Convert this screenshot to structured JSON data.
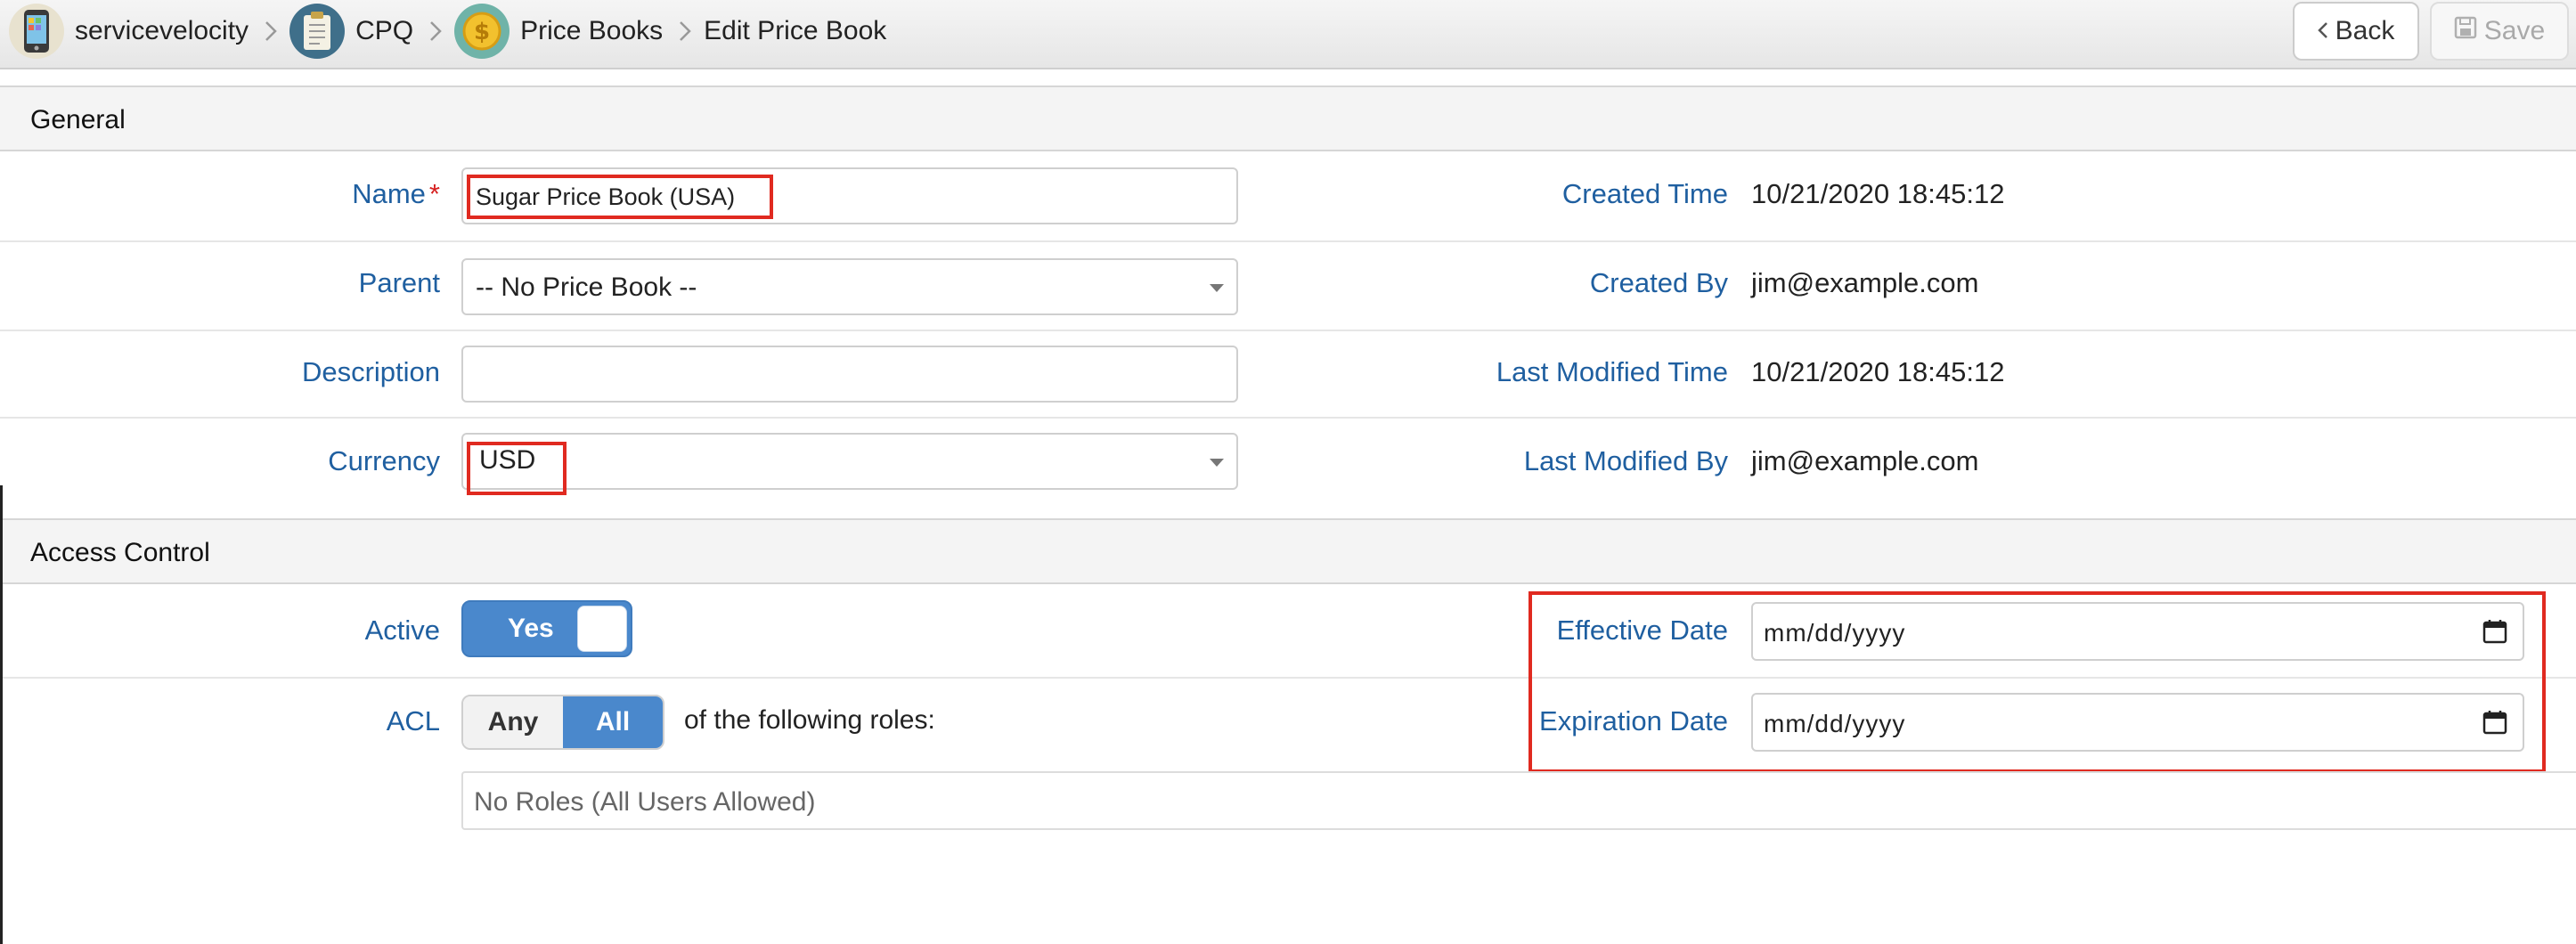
{
  "breadcrumb": {
    "items": [
      {
        "label": "servicevelocity",
        "icon": "phone-app-icon"
      },
      {
        "label": "CPQ",
        "icon": "clipboard-icon"
      },
      {
        "label": "Price Books",
        "icon": "dollar-coin-icon"
      }
    ],
    "current": "Edit Price Book"
  },
  "toolbar": {
    "back_label": "Back",
    "save_label": "Save"
  },
  "general": {
    "title": "General",
    "fields": {
      "name": {
        "label": "Name",
        "required_mark": "*",
        "value": "Sugar Price Book (USA)"
      },
      "parent": {
        "label": "Parent",
        "value": "-- No Price Book --"
      },
      "description": {
        "label": "Description",
        "value": ""
      },
      "currency": {
        "label": "Currency",
        "value": "USD"
      }
    },
    "info": {
      "created_time": {
        "label": "Created Time",
        "value": "10/21/2020 18:45:12"
      },
      "created_by": {
        "label": "Created By",
        "value": "jim@example.com"
      },
      "last_modified_time": {
        "label": "Last Modified Time",
        "value": "10/21/2020 18:45:12"
      },
      "last_modified_by": {
        "label": "Last Modified By",
        "value": "jim@example.com"
      }
    }
  },
  "access_control": {
    "title": "Access Control",
    "active": {
      "label": "Active",
      "value": "Yes"
    },
    "acl": {
      "label": "ACL",
      "options": [
        "Any",
        "All"
      ],
      "selected": "All",
      "suffix": "of the following roles:"
    },
    "roles_placeholder": "No Roles (All Users Allowed)",
    "effective_date": {
      "label": "Effective Date",
      "placeholder": "mm/dd/yyyy"
    },
    "expiration_date": {
      "label": "Expiration Date",
      "placeholder": "mm/dd/yyyy"
    }
  },
  "colors": {
    "accent": "#4a88cc",
    "label_blue": "#1f5fa0",
    "highlight_red": "#e02a20",
    "required_red": "#d62020"
  }
}
